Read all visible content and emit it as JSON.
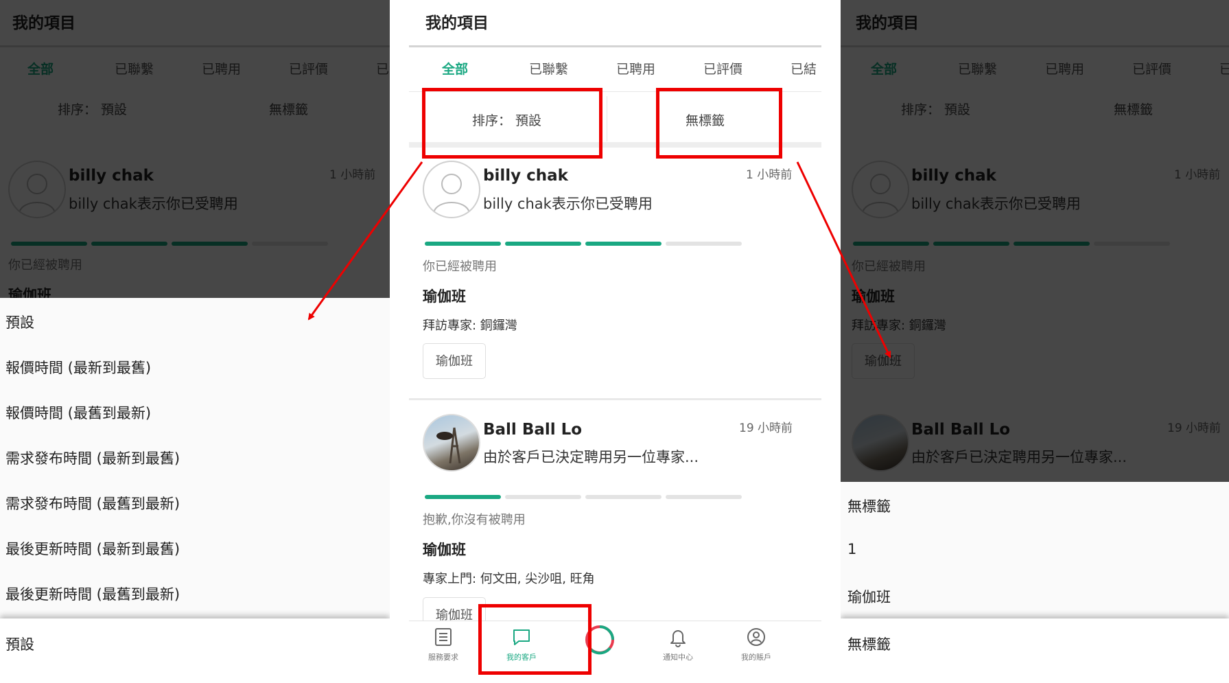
{
  "app": {
    "title": "我的項目"
  },
  "tabs": [
    "全部",
    "已聯繫",
    "已聘用",
    "已評價",
    "已結"
  ],
  "filters": {
    "sort_label": "排序： 預設",
    "tag_label": "無標籤"
  },
  "cards": [
    {
      "name": "billy chak",
      "time": "1 小時前",
      "message": "billy chak表示你已受聘用",
      "progress_done": 3,
      "progress_total": 4,
      "status": "你已經被聘用",
      "job_title": "瑜伽班",
      "job_detail": "拜訪專家: 銅鑼灣",
      "tag": "瑜伽班"
    },
    {
      "name": "Ball Ball Lo",
      "time": "19 小時前",
      "message": "由於客戶已決定聘用另一位專家...",
      "progress_done": 1,
      "progress_total": 4,
      "status": "抱歉,你沒有被聘用",
      "job_title": "瑜伽班",
      "job_detail": "專家上門: 何文田, 尖沙咀, 旺角",
      "tag": "瑜伽班"
    }
  ],
  "nav": {
    "items": [
      {
        "label": "服務要求",
        "icon": "list-icon"
      },
      {
        "label": "我的客戶",
        "icon": "chat-icon"
      },
      {
        "label": "",
        "icon": "loading-spinner-icon"
      },
      {
        "label": "通知中心",
        "icon": "bell-icon"
      },
      {
        "label": "我的賬戶",
        "icon": "account-icon"
      }
    ],
    "active_index": 1
  },
  "sort_sheet": {
    "options": [
      "預設",
      "報價時間 (最新到最舊)",
      "報價時間 (最舊到最新)",
      "需求發布時間 (最新到最舊)",
      "需求發布時間 (最舊到最新)",
      "最後更新時間 (最新到最舊)",
      "最後更新時間 (最舊到最新)"
    ],
    "footer": "預設"
  },
  "tag_sheet": {
    "options": [
      "無標籤",
      "1",
      "瑜伽班"
    ],
    "footer": "無標籤"
  },
  "colors": {
    "accent": "#1aa882",
    "highlight": "#ee0000",
    "overlay": "#000000",
    "progress_track": "#e3e3e3"
  }
}
